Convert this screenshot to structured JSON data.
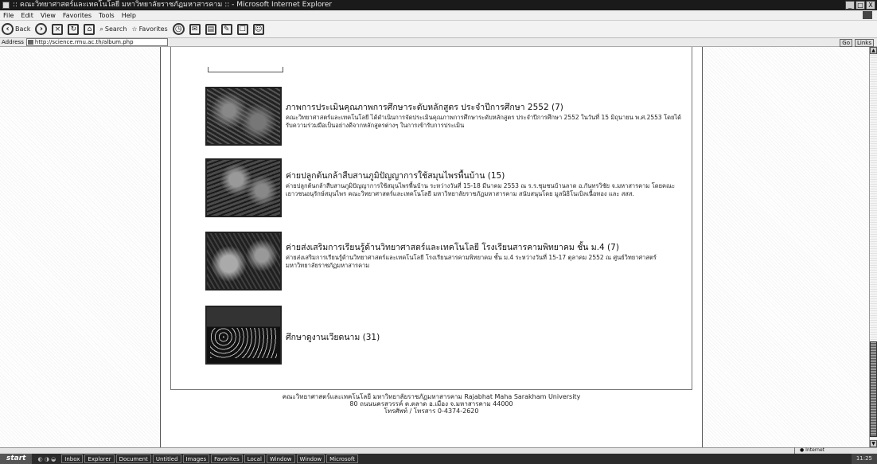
{
  "window": {
    "title": ":: คณะวิทยาศาสตร์และเทคโนโลยี มหาวิทยาลัยราชภัฏมหาสารคาม :: - Microsoft Internet Explorer",
    "buttons": [
      "_",
      "□",
      "X"
    ]
  },
  "menu": [
    "File",
    "Edit",
    "View",
    "Favorites",
    "Tools",
    "Help"
  ],
  "toolbar": {
    "back": "Back",
    "search": "Search",
    "favorites": "Favorites"
  },
  "address": {
    "label": "Address",
    "url": "http://science.rmu.ac.th/album.php",
    "go": "Go",
    "links": "Links"
  },
  "albums": [
    {
      "title": "ภาพการประเมินคุณภาพการศึกษาระดับหลักสูตร ประจำปีการศึกษา 2552 (7)",
      "desc": "คณะวิทยาศาสตร์และเทคโนโลยี ได้ดำเนินการจัดประเมินคุณภาพการศึกษาระดับหลักสูตร ประจำปีการศึกษา 2552 ในวันที่ 15 มิถุนายน พ.ศ.2553 โดยได้รับความร่วมมือเป็นอย่างดีจากหลักสูตรต่างๆ ในการเข้ารับการประเมิน"
    },
    {
      "title": "ค่ายปลูกต้นกล้าสืบสานภูมิปัญญาการใช้สมุนไพรพื้นบ้าน (15)",
      "desc": "ค่ายปลูกต้นกล้าสืบสานภูมิปัญญาการใช้สมุนไพรพื้นบ้าน ระหว่างวันที่ 15-18 มีนาคม 2553 ณ ร.ร.ชุมชนบ้านลาด อ.กันทรวิชัย จ.มหาสารคาม โดยคณะเยาวชนอนุรักษ์สมุนไพร คณะวิทยาศาสตร์และเทคโนโลยี มหาวิทยาลัยราชภัฏมหาสารคาม สนับสนุนโดย มูลนิธิโนเบิลเนื้อทอง และ สสส."
    },
    {
      "title": "ค่ายส่งเสริมการเรียนรู้ด้านวิทยาศาสตร์และเทคโนโลยี โรงเรียนสารคามพิทยาคม ชั้น ม.4 (7)",
      "desc": "ค่ายส่งเสริมการเรียนรู้ด้านวิทยาศาสตร์และเทคโนโลยี โรงเรียนสารคามพิทยาคม ชั้น ม.4 ระหว่างวันที่ 15-17 ตุลาคม 2552 ณ ศูนย์วิทยาศาสตร์ มหาวิทยาลัยราชภัฏมหาสารคาม"
    },
    {
      "title": "ศึกษาดูงานเวียดนาม (31)",
      "desc": ""
    }
  ],
  "footer": {
    "line1": "คณะวิทยาศาสตร์และเทคโนโลยี มหาวิทยาลัยราชภัฏมหาสารคาม Rajabhat Maha Sarakham University",
    "line2": "80 ถนนนครสวรรค์ ต.ตลาด อ.เมือง จ.มหาสารคาม 44000",
    "line3": "โทรศัพท์ / โทรสาร 0-4374-2620"
  },
  "status": {
    "zone": "Internet"
  },
  "taskbar": {
    "start": "start",
    "tasks": [
      "Inbox",
      "Explorer",
      "Document",
      "Untitled",
      "Images",
      "Favorites",
      "Local",
      "Window",
      "Window",
      "Microsoft"
    ],
    "clock": "11:25"
  }
}
